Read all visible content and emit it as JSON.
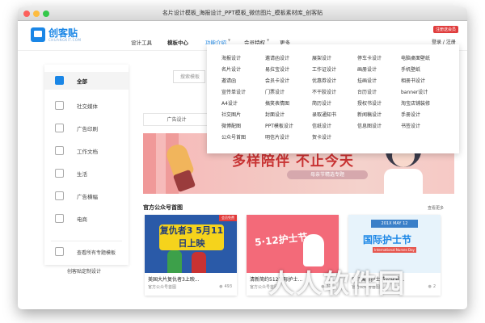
{
  "window": {
    "title": "名片设计模板_海报设计_PPT模板_微信图片_模板素材库_创客贴"
  },
  "logo": {
    "name": "创客贴",
    "sub": "CHUANGKIT.COM"
  },
  "nav": {
    "items": [
      "设计工具",
      "模板中心",
      "功能介绍",
      "会员特权",
      "更多"
    ],
    "badge": "注册送会员",
    "login": "登录 / 注册"
  },
  "sidebar": {
    "items": [
      {
        "label": "全部",
        "icon": "home-icon"
      },
      {
        "label": "社交媒体",
        "icon": "chat-icon"
      },
      {
        "label": "广告印刷",
        "icon": "print-icon"
      },
      {
        "label": "工作文档",
        "icon": "document-icon"
      },
      {
        "label": "生活",
        "icon": "cup-icon"
      },
      {
        "label": "广告横幅",
        "icon": "banner-icon"
      },
      {
        "label": "电商",
        "icon": "shop-icon"
      }
    ],
    "all_topics": "查看所有专题模板",
    "custom": "创客贴定制设计"
  },
  "search": {
    "placeholder": "搜索模板"
  },
  "tabs": {
    "first": "广告设计"
  },
  "dropdown": {
    "columns": [
      [
        "海报设计",
        "名片设计",
        "邀请函",
        "宣传单设计",
        "A4设计",
        "社交图片",
        "微博配图",
        "公众号首图"
      ],
      [
        "邀请函设计",
        "易拉宝设计",
        "会员卡设计",
        "门票设计",
        "搞笑表情图",
        "封面设计",
        "PPT模板设计",
        "明信片设计"
      ],
      [
        "展架设计",
        "工作证设计",
        "优惠券设计",
        "不干胶设计",
        "简历设计",
        "录取通知书",
        "信纸设计",
        "贺卡设计"
      ],
      [
        "停车卡设计",
        "画册设计",
        "挂画设计",
        "台历设计",
        "授权书设计",
        "新闻稿设计",
        "信息图设计",
        ""
      ],
      [
        "电脑桌面壁纸",
        "手机壁纸",
        "相册书设计",
        "banner设计",
        "淘宝店铺装修",
        "手册设计",
        "书签设计",
        ""
      ]
    ]
  },
  "banner": {
    "headline": "多样陪伴 不止今天",
    "subline": "母亲节精选专题"
  },
  "section": {
    "title": "官方公众号首图",
    "more": "查看更多"
  },
  "cards": [
    {
      "art_tag": "会员免费",
      "art_title": "复仇者3 5月11日上映",
      "title": "美国大片复仇者3上映...",
      "sub": "官方公众号首图",
      "stat": "493"
    },
    {
      "art_title": "5·12护士节",
      "title": "清新简约512国际护士...",
      "sub": "官方公众号首图",
      "stat": "321"
    },
    {
      "art_tag": "201X MAY 12",
      "art_title": "国际护士节",
      "art_sub": "International Nurses Day",
      "title": "512国际护士节公众号...",
      "sub": "官方公众号首图",
      "stat": "2"
    }
  ],
  "watermark": "人人软件园"
}
